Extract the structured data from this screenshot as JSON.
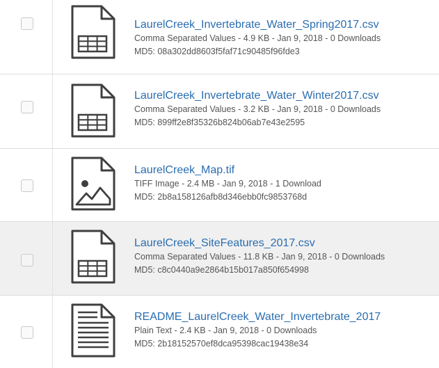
{
  "files": [
    {
      "name": "LaurelCreek_Invertebrate_Water_Spring2017.csv",
      "meta": "Comma Separated Values - 4.9 KB - Jan 9, 2018 - 0 Downloads",
      "md5": "MD5: 08a302dd8603f5faf71c90485f96fde3",
      "icon": "spreadsheet-file-icon"
    },
    {
      "name": "LaurelCreek_Invertebrate_Water_Winter2017.csv",
      "meta": "Comma Separated Values - 3.2 KB - Jan 9, 2018 - 0 Downloads",
      "md5": "MD5: 899ff2e8f35326b824b06ab7e43e2595",
      "icon": "spreadsheet-file-icon"
    },
    {
      "name": "LaurelCreek_Map.tif",
      "meta": "TIFF Image - 2.4 MB - Jan 9, 2018 - 1 Download",
      "md5": "MD5: 2b8a158126afb8d346ebb0fc9853768d",
      "icon": "image-file-icon"
    },
    {
      "name": "LaurelCreek_SiteFeatures_2017.csv",
      "meta": "Comma Separated Values - 11.8 KB - Jan 9, 2018 - 0 Downloads",
      "md5": "MD5: c8c0440a9e2864b15b017a850f654998",
      "icon": "spreadsheet-file-icon"
    },
    {
      "name": "README_LaurelCreek_Water_Invertebrate_2017",
      "meta": "Plain Text - 2.4 KB - Jan 9, 2018 - 0 Downloads",
      "md5": "MD5: 2b18152570ef8dca95398cac19438e34",
      "icon": "text-file-icon"
    }
  ],
  "colors": {
    "link": "#2a6db0",
    "meta_text": "#555555",
    "icon_stroke": "#3f3f3f",
    "row_highlight": "#f0f0f0"
  }
}
